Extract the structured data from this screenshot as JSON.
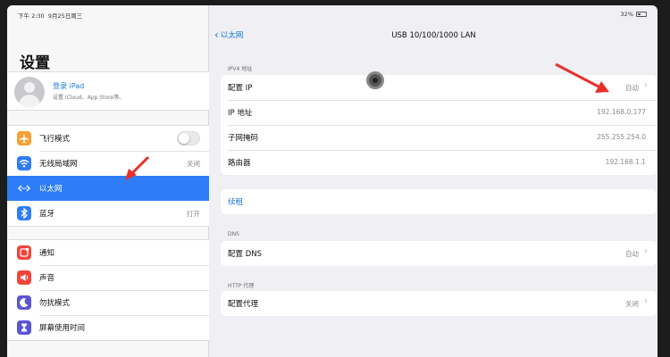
{
  "status_bar": {
    "time": "下午 2:30",
    "date": "9月25日周三",
    "battery": "32%"
  },
  "sidebar": {
    "title": "设置",
    "account": {
      "name": "登录 iPad",
      "subtitle": "设置 iCloud、App Store等。"
    },
    "group1": [
      {
        "label": "飞行模式",
        "icon": "airplane-icon",
        "color": "#f7a033",
        "value": ""
      },
      {
        "label": "无线局域网",
        "icon": "wifi-icon",
        "color": "#2f7df6",
        "value": "关闭"
      },
      {
        "label": "以太网",
        "icon": "ethernet-icon",
        "color": "#2f7df6",
        "value": ""
      },
      {
        "label": "蓝牙",
        "icon": "bluetooth-icon",
        "color": "#2f7df6",
        "value": "打开"
      }
    ],
    "group2": [
      {
        "label": "通知",
        "icon": "notifications-icon",
        "color": "#f0453a"
      },
      {
        "label": "声音",
        "icon": "sound-icon",
        "color": "#f0453a"
      },
      {
        "label": "勿扰模式",
        "icon": "moon-icon",
        "color": "#5b55d6"
      },
      {
        "label": "屏幕使用时间",
        "icon": "hourglass-icon",
        "color": "#5b55d6"
      }
    ]
  },
  "detail": {
    "back_label": "以太网",
    "title": "USB 10/100/1000 LAN",
    "ipv4_header": "IPV4 地址",
    "ipv4_rows": [
      {
        "label": "配置 IP",
        "value": "自动",
        "chevron": true
      },
      {
        "label": "IP 地址",
        "value": "192.168.0.177",
        "chevron": false
      },
      {
        "label": "子网掩码",
        "value": "255.255.254.0",
        "chevron": false
      },
      {
        "label": "路由器",
        "value": "192.168.1.1",
        "chevron": false
      }
    ],
    "lease_link": "续租",
    "dns_header": "DNS",
    "dns_row": {
      "label": "配置 DNS",
      "value": "自动"
    },
    "proxy_header": "HTTP 代理",
    "proxy_row": {
      "label": "配置代理",
      "value": "关闭"
    }
  },
  "colors": {
    "accent": "#2f7df6",
    "link": "#1a7bd8",
    "annotation": "#e8302a"
  }
}
